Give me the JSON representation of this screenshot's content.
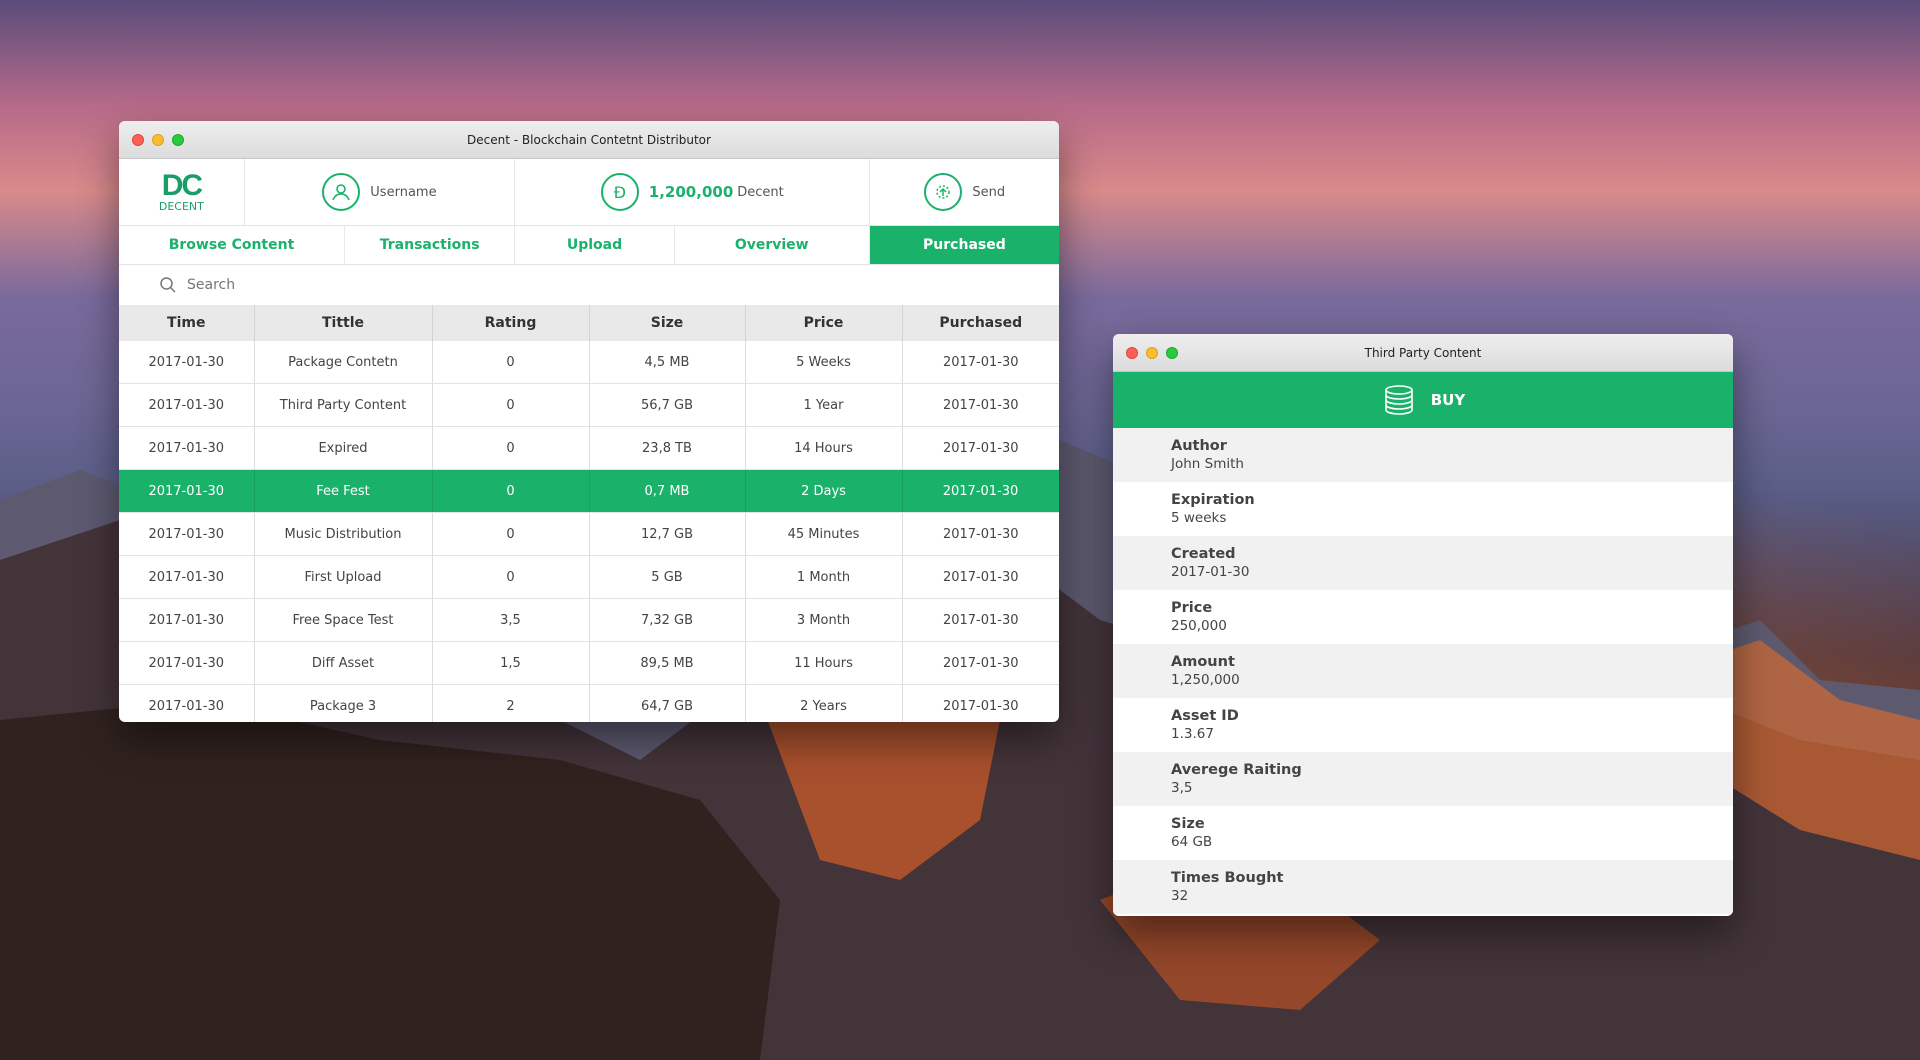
{
  "main_window": {
    "title": "Decent - Blockchain Contetnt Distributor",
    "logo_mark": "DC",
    "logo_text": "DECENT",
    "username": "Username",
    "balance_value": "1,200,000",
    "balance_unit": "Decent",
    "send_label": "Send",
    "tabs": [
      "Browse Content",
      "Transactions",
      "Upload",
      "Overview",
      "Purchased"
    ],
    "active_tab": "Purchased",
    "search_placeholder": "Search",
    "columns": [
      "Time",
      "Tittle",
      "Rating",
      "Size",
      "Price",
      "Purchased"
    ],
    "rows": [
      {
        "time": "2017-01-30",
        "title": "Package Contetn",
        "rating": "0",
        "size": "4,5 MB",
        "price": "5 Weeks",
        "purchased": "2017-01-30"
      },
      {
        "time": "2017-01-30",
        "title": "Third Party Content",
        "rating": "0",
        "size": "56,7 GB",
        "price": "1 Year",
        "purchased": "2017-01-30"
      },
      {
        "time": "2017-01-30",
        "title": "Expired",
        "rating": "0",
        "size": "23,8 TB",
        "price": "14 Hours",
        "purchased": "2017-01-30"
      },
      {
        "time": "2017-01-30",
        "title": "Fee Fest",
        "rating": "0",
        "size": "0,7 MB",
        "price": "2 Days",
        "purchased": "2017-01-30"
      },
      {
        "time": "2017-01-30",
        "title": "Music Distribution",
        "rating": "0",
        "size": "12,7 GB",
        "price": "45 Minutes",
        "purchased": "2017-01-30"
      },
      {
        "time": "2017-01-30",
        "title": "First Upload",
        "rating": "0",
        "size": "5 GB",
        "price": "1 Month",
        "purchased": "2017-01-30"
      },
      {
        "time": "2017-01-30",
        "title": "Free Space Test",
        "rating": "3,5",
        "size": "7,32 GB",
        "price": "3 Month",
        "purchased": "2017-01-30"
      },
      {
        "time": "2017-01-30",
        "title": "Diff Asset",
        "rating": "1,5",
        "size": "89,5 MB",
        "price": "11 Hours",
        "purchased": "2017-01-30"
      },
      {
        "time": "2017-01-30",
        "title": "Package 3",
        "rating": "2",
        "size": "64,7 GB",
        "price": "2 Years",
        "purchased": "2017-01-30"
      }
    ],
    "selected_row": 3
  },
  "detail_window": {
    "title": "Third Party Content",
    "buy_label": "BUY",
    "fields": [
      {
        "label": "Author",
        "value": "John Smith"
      },
      {
        "label": "Expiration",
        "value": "5 weeks"
      },
      {
        "label": "Created",
        "value": "2017-01-30"
      },
      {
        "label": "Price",
        "value": "250,000"
      },
      {
        "label": "Amount",
        "value": "1,250,000"
      },
      {
        "label": "Asset ID",
        "value": "1.3.67"
      },
      {
        "label": "Averege Raiting",
        "value": "3,5"
      },
      {
        "label": "Size",
        "value": "64 GB"
      },
      {
        "label": "Times Bought",
        "value": "32"
      }
    ]
  },
  "colors": {
    "accent": "#1ab26b",
    "traffic_red": "#fc5f57",
    "traffic_yellow": "#fdbc2e",
    "traffic_green": "#29c940"
  }
}
